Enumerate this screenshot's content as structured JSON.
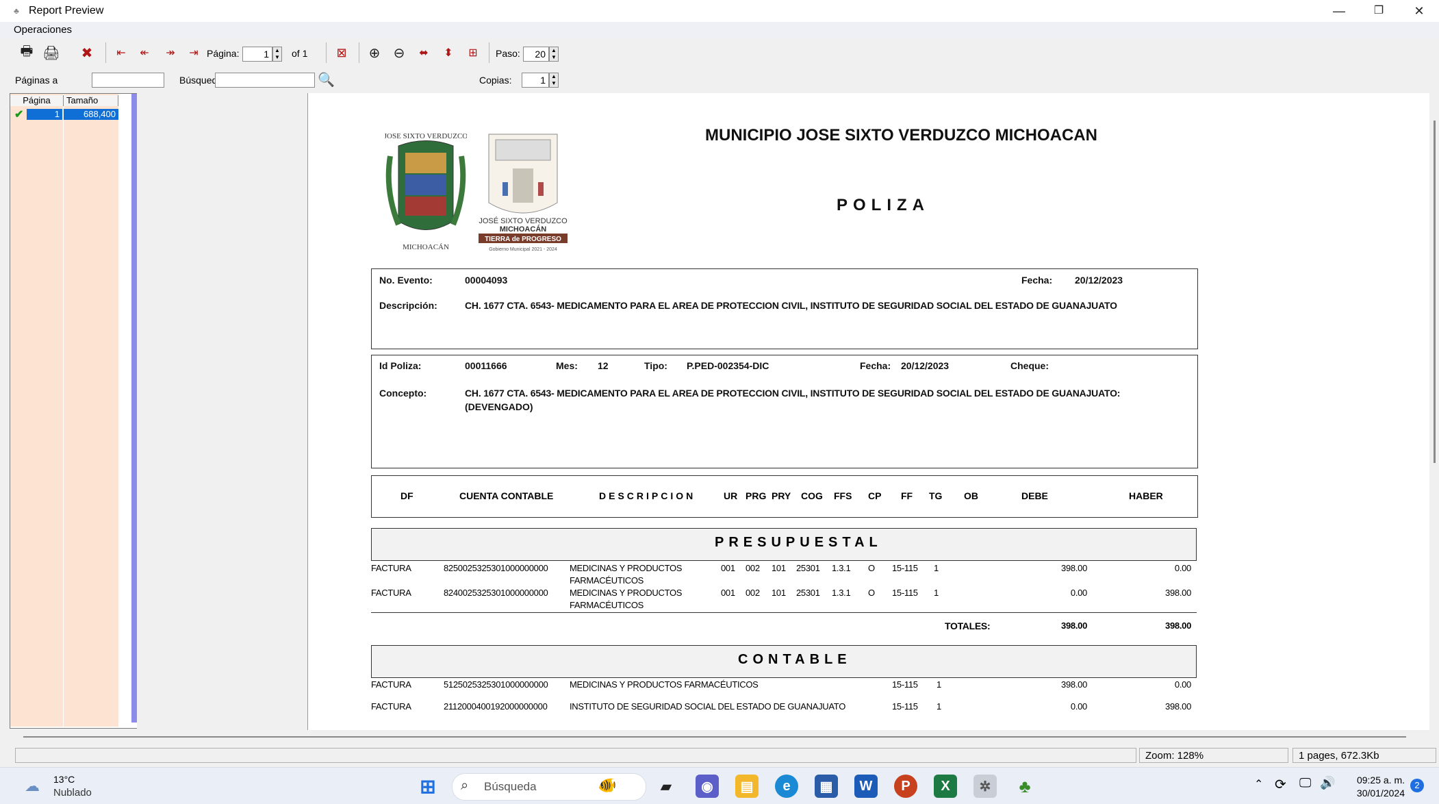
{
  "window": {
    "title": "Report Preview",
    "minimize_icon": "minimize-icon",
    "restore_icon": "restore-icon",
    "close_icon": "close-icon"
  },
  "menu": {
    "operaciones": "Operaciones"
  },
  "toolbar": {
    "pagina_label": "Página:",
    "pagina_value": "1",
    "of_label": "of 1",
    "paso_label": "Paso:",
    "paso_value": "20"
  },
  "bar2": {
    "paginas_label": "Páginas a",
    "busqueda_label": "Búsqued",
    "copias_label": "Copias:",
    "copias_value": "1"
  },
  "page_list": {
    "headers": [
      "Página",
      "Tamaño"
    ],
    "rows": [
      {
        "page": "1",
        "size": "688,400"
      }
    ]
  },
  "report": {
    "title": "MUNICIPIO JOSE SIXTO VERDUZCO MICHOACAN",
    "subtitle": "POLIZA",
    "logo1_top": "JOSE SIXTO VERDUZCO",
    "logo1_bottom": "MICHOACÁN",
    "logo2_line1": "JOSÉ SIXTO VERDUZCO",
    "logo2_line2": "MICHOACÁN",
    "logo2_line3": "TIERRA de PROGRESO",
    "logo2_line4": "Gobierno Municipal 2021 - 2024",
    "no_evento_label": "No. Evento:",
    "no_evento": "00004093",
    "fecha_label": "Fecha:",
    "fecha": "20/12/2023",
    "descripcion_label": "Descripción:",
    "descripcion": "CH. 1677 CTA. 6543- MEDICAMENTO PARA EL AREA DE PROTECCION CIVIL, INSTITUTO DE SEGURIDAD SOCIAL DEL ESTADO DE GUANAJUATO",
    "id_poliza_label": "Id Poliza:",
    "id_poliza": "00011666",
    "mes_label": "Mes:",
    "mes": "12",
    "tipo_label": "Tipo:",
    "tipo": "P.PED-002354-DIC",
    "fecha2_label": "Fecha:",
    "fecha2": "20/12/2023",
    "cheque_label": "Cheque:",
    "concepto_label": "Concepto:",
    "concepto_line1": "CH. 1677 CTA. 6543- MEDICAMENTO PARA EL AREA DE PROTECCION CIVIL, INSTITUTO DE SEGURIDAD SOCIAL DEL ESTADO DE GUANAJUATO:",
    "concepto_line2": "(DEVENGADO)",
    "columns": [
      "DF",
      "CUENTA CONTABLE",
      "DESCRIPCION",
      "UR",
      "PRG",
      "PRY",
      "COG",
      "FFS",
      "CP",
      "FF",
      "TG",
      "OB",
      "DEBE",
      "HABER"
    ],
    "presupuestal_title": "PRESUPUESTAL",
    "presupuestal_rows": [
      {
        "df": "FACTURA",
        "cuenta": "8250025325301000000000",
        "desc1": "MEDICINAS Y PRODUCTOS",
        "desc2": "FARMACÉUTICOS",
        "ur": "001",
        "prg": "002",
        "pry": "101",
        "cog": "25301",
        "ffs": "1.3.1",
        "cp": "O",
        "ff": "15-115",
        "tg": "1",
        "debe": "398.00",
        "haber": "0.00"
      },
      {
        "df": "FACTURA",
        "cuenta": "8240025325301000000000",
        "desc1": "MEDICINAS Y PRODUCTOS",
        "desc2": "FARMACÉUTICOS",
        "ur": "001",
        "prg": "002",
        "pry": "101",
        "cog": "25301",
        "ffs": "1.3.1",
        "cp": "O",
        "ff": "15-115",
        "tg": "1",
        "debe": "0.00",
        "haber": "398.00"
      }
    ],
    "totales_label": "TOTALES:",
    "totales_debe": "398.00",
    "totales_haber": "398.00",
    "contable_title": "CONTABLE",
    "contable_rows": [
      {
        "df": "FACTURA",
        "cuenta": "5125025325301000000000",
        "desc": "MEDICINAS Y PRODUCTOS FARMACÉUTICOS",
        "ff": "15-115",
        "tg": "1",
        "debe": "398.00",
        "haber": "0.00"
      },
      {
        "df": "FACTURA",
        "cuenta": "2112000400192000000000",
        "desc": "INSTITUTO DE SEGURIDAD SOCIAL DEL ESTADO DE GUANAJUATO",
        "ff": "15-115",
        "tg": "1",
        "debe": "0.00",
        "haber": "398.00"
      }
    ]
  },
  "status": {
    "zoom": "Zoom: 128%",
    "pages": "1 pages, 672.3Kb"
  },
  "taskbar": {
    "weather_temp": "13°C",
    "weather_desc": "Nublado",
    "search_placeholder": "Búsqueda",
    "time": "09:25 a. m.",
    "date": "30/01/2024",
    "notif_count": "2"
  }
}
